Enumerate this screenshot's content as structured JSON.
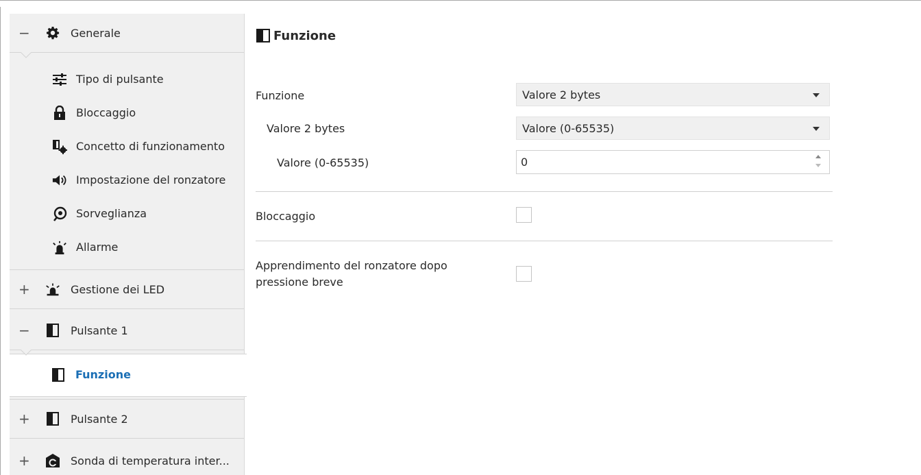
{
  "sidebar": {
    "groups": [
      {
        "toggle": "−",
        "icon": "gear-icon",
        "label": "Generale"
      },
      {
        "toggle": "+",
        "icon": "led-icon",
        "label": "Gestione dei LED"
      },
      {
        "toggle": "−",
        "icon": "pushbutton-icon",
        "label": "Pulsante 1"
      },
      {
        "toggle": "+",
        "icon": "pushbutton-icon",
        "label": "Pulsante 2"
      },
      {
        "toggle": "+",
        "icon": "temperature-probe-icon",
        "label": "Sonda di temperatura inter..."
      }
    ],
    "generale_items": [
      {
        "icon": "sliders-icon",
        "label": "Tipo di pulsante"
      },
      {
        "icon": "lock-icon",
        "label": "Bloccaggio"
      },
      {
        "icon": "concept-settings-icon",
        "label": "Concetto di funzionamento"
      },
      {
        "icon": "speaker-icon",
        "label": "Impostazione del ronzatore"
      },
      {
        "icon": "eye-icon",
        "label": "Sorveglianza"
      },
      {
        "icon": "alarm-light-icon",
        "label": "Allarme"
      }
    ],
    "selected_item": {
      "icon": "pushbutton-icon",
      "label": "Funzione"
    }
  },
  "main": {
    "title": "Funzione",
    "params": {
      "funzione_label": "Funzione",
      "funzione_value": "Valore 2 bytes",
      "valore2_label": "Valore 2 bytes",
      "valore2_value": "Valore (0-65535)",
      "valore_label": "Valore (0-65535)",
      "valore_value": "0",
      "bloccaggio_label": "Bloccaggio",
      "bloccaggio_checked": false,
      "apprendimento_label_1": "Apprendimento del ronzatore dopo",
      "apprendimento_label_2": "pressione breve",
      "apprendimento_checked": false
    }
  },
  "colors": {
    "selected_text": "#1b6fb5",
    "sidebar_bg": "#f0f0f0"
  }
}
